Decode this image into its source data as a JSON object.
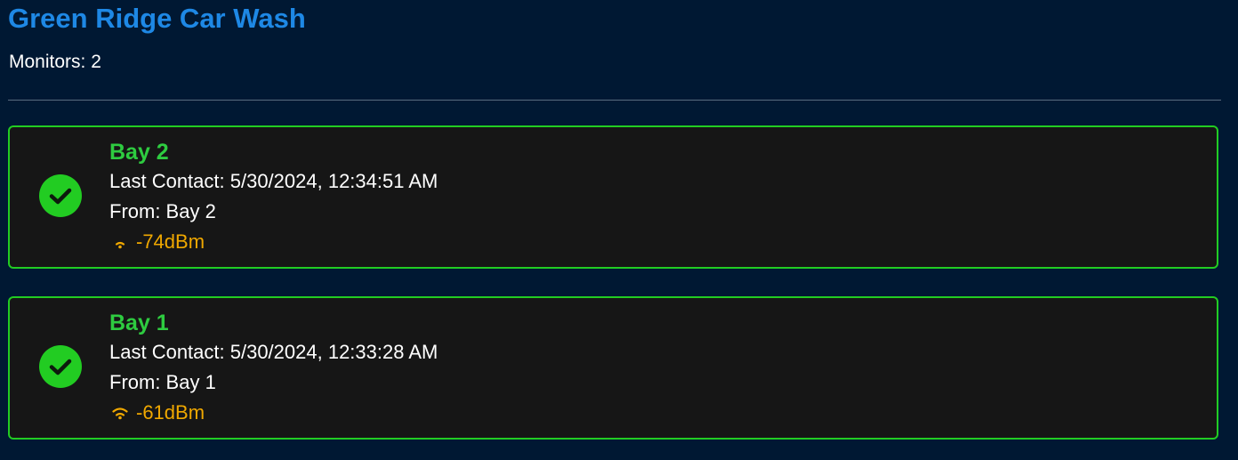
{
  "site": {
    "title": "Green Ridge Car Wash",
    "monitors_text": "Monitors: 2"
  },
  "cards": [
    {
      "name": "Bay 2",
      "last_contact": "Last Contact: 5/30/2024, 12:34:51 AM",
      "from": "From: Bay 2",
      "signal": "-74dBm",
      "status_icon": "check-circle-icon",
      "signal_icon": "wifi-weak-icon"
    },
    {
      "name": "Bay 1",
      "last_contact": "Last Contact: 5/30/2024, 12:33:28 AM",
      "from": "From: Bay 1",
      "signal": "-61dBm",
      "status_icon": "check-circle-icon",
      "signal_icon": "wifi-medium-icon"
    }
  ],
  "colors": {
    "background": "#001833",
    "title": "#1e88e5",
    "card_border": "#22cc22",
    "card_name": "#2ecc40",
    "signal_text": "#f0a800"
  }
}
